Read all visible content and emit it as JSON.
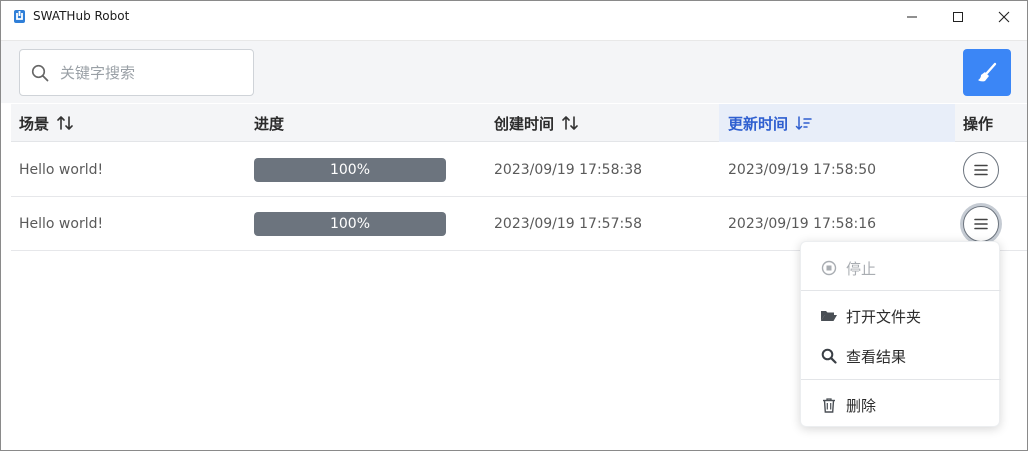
{
  "window": {
    "title": "SWATHub Robot",
    "controls": [
      "minimize",
      "maximize",
      "close"
    ]
  },
  "toolbar": {
    "search_placeholder": "关键字搜索",
    "search_value": "",
    "clear_button_icon": "broom-icon",
    "accent_color": "#3b86f6"
  },
  "table": {
    "columns": [
      {
        "label": "场景",
        "sortable": true,
        "sort_state": "none"
      },
      {
        "label": "进度",
        "sortable": false
      },
      {
        "label": "创建时间",
        "sortable": true,
        "sort_state": "none"
      },
      {
        "label": "更新时间",
        "sortable": true,
        "sort_state": "descending",
        "active": true
      },
      {
        "label": "操作",
        "sortable": false
      }
    ],
    "rows": [
      {
        "scene": "Hello world!",
        "progress": 100,
        "progress_label": "100%",
        "created": "2023/09/19 17:58:38",
        "updated": "2023/09/19 17:58:50"
      },
      {
        "scene": "Hello world!",
        "progress": 100,
        "progress_label": "100%",
        "created": "2023/09/19 17:57:58",
        "updated": "2023/09/19 17:58:16"
      }
    ]
  },
  "menu": {
    "items": [
      {
        "label": "停止",
        "icon": "stop-circle-icon",
        "disabled": true
      },
      {
        "label": "打开文件夹",
        "icon": "folder-open-icon",
        "disabled": false
      },
      {
        "label": "查看结果",
        "icon": "search-icon",
        "disabled": false
      },
      {
        "label": "删除",
        "icon": "trash-icon",
        "disabled": false
      }
    ]
  }
}
